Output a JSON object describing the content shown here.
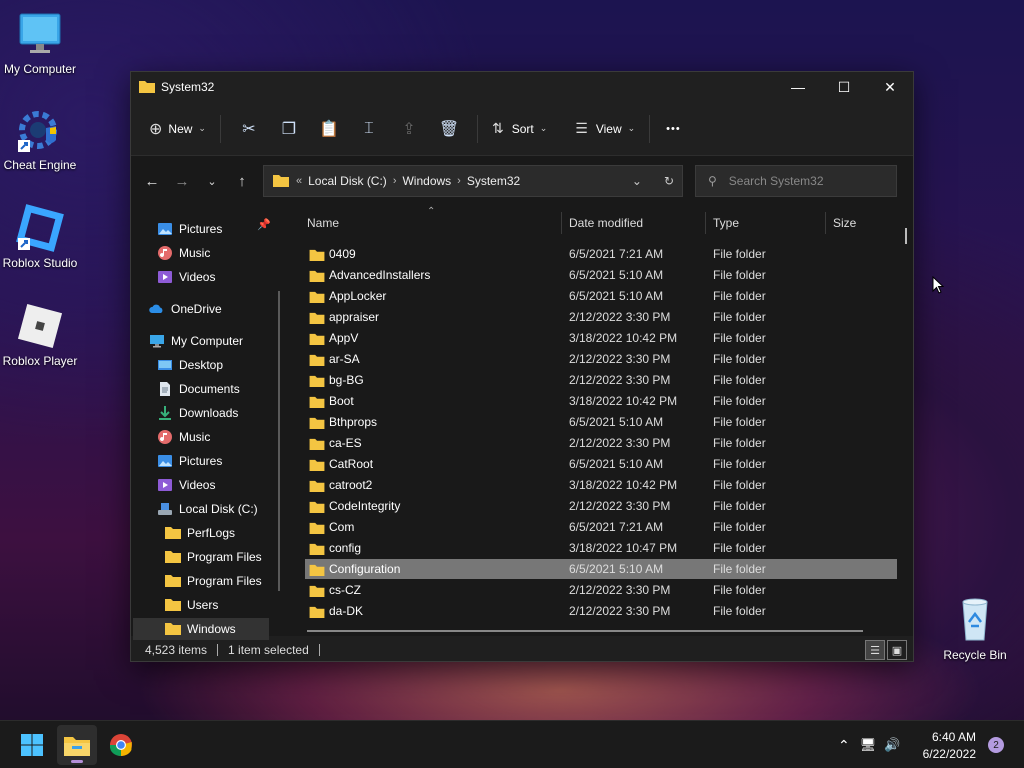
{
  "desktop": {
    "icons": [
      {
        "label": "My Computer"
      },
      {
        "label": "Cheat Engine"
      },
      {
        "label": "Roblox Studio"
      },
      {
        "label": "Roblox Player"
      },
      {
        "label": "Recycle Bin"
      }
    ]
  },
  "window": {
    "title": "System32",
    "controls": {
      "minimize": "—",
      "maximize": "☐",
      "close": "✕"
    }
  },
  "toolbar": {
    "new_label": "New",
    "sort_label": "Sort",
    "view_label": "View",
    "more_label": "•••"
  },
  "address": {
    "prefix": "«",
    "crumbs": [
      "Local Disk (C:)",
      "Windows",
      "System32"
    ],
    "search_placeholder": "Search System32"
  },
  "nav": {
    "items": [
      {
        "label": "Pictures",
        "icon": "pictures-icon"
      },
      {
        "label": "Music",
        "icon": "music-icon"
      },
      {
        "label": "Videos",
        "icon": "videos-icon"
      },
      {
        "label": "OneDrive",
        "icon": "onedrive-icon"
      },
      {
        "label": "My Computer",
        "icon": "computer-icon"
      },
      {
        "label": "Desktop",
        "icon": "desktop-icon"
      },
      {
        "label": "Documents",
        "icon": "documents-icon"
      },
      {
        "label": "Downloads",
        "icon": "downloads-icon"
      },
      {
        "label": "Music",
        "icon": "music-icon"
      },
      {
        "label": "Pictures",
        "icon": "pictures-icon"
      },
      {
        "label": "Videos",
        "icon": "videos-icon"
      },
      {
        "label": "Local Disk (C:)",
        "icon": "drive-icon"
      },
      {
        "label": "PerfLogs",
        "icon": "folder-icon"
      },
      {
        "label": "Program Files",
        "icon": "folder-icon"
      },
      {
        "label": "Program Files",
        "icon": "folder-icon"
      },
      {
        "label": "Users",
        "icon": "folder-icon"
      },
      {
        "label": "Windows",
        "icon": "folder-icon"
      }
    ]
  },
  "columns": {
    "name": "Name",
    "date": "Date modified",
    "type": "Type",
    "size": "Size"
  },
  "files": [
    {
      "name": "0409",
      "date": "6/5/2021 7:21 AM",
      "type": "File folder"
    },
    {
      "name": "AdvancedInstallers",
      "date": "6/5/2021 5:10 AM",
      "type": "File folder"
    },
    {
      "name": "AppLocker",
      "date": "6/5/2021 5:10 AM",
      "type": "File folder"
    },
    {
      "name": "appraiser",
      "date": "2/12/2022 3:30 PM",
      "type": "File folder"
    },
    {
      "name": "AppV",
      "date": "3/18/2022 10:42 PM",
      "type": "File folder"
    },
    {
      "name": "ar-SA",
      "date": "2/12/2022 3:30 PM",
      "type": "File folder"
    },
    {
      "name": "bg-BG",
      "date": "2/12/2022 3:30 PM",
      "type": "File folder"
    },
    {
      "name": "Boot",
      "date": "3/18/2022 10:42 PM",
      "type": "File folder"
    },
    {
      "name": "Bthprops",
      "date": "6/5/2021 5:10 AM",
      "type": "File folder"
    },
    {
      "name": "ca-ES",
      "date": "2/12/2022 3:30 PM",
      "type": "File folder"
    },
    {
      "name": "CatRoot",
      "date": "6/5/2021 5:10 AM",
      "type": "File folder"
    },
    {
      "name": "catroot2",
      "date": "3/18/2022 10:42 PM",
      "type": "File folder"
    },
    {
      "name": "CodeIntegrity",
      "date": "2/12/2022 3:30 PM",
      "type": "File folder"
    },
    {
      "name": "Com",
      "date": "6/5/2021 7:21 AM",
      "type": "File folder"
    },
    {
      "name": "config",
      "date": "3/18/2022 10:47 PM",
      "type": "File folder"
    },
    {
      "name": "Configuration",
      "date": "6/5/2021 5:10 AM",
      "type": "File folder"
    },
    {
      "name": "cs-CZ",
      "date": "2/12/2022 3:30 PM",
      "type": "File folder"
    },
    {
      "name": "da-DK",
      "date": "2/12/2022 3:30 PM",
      "type": "File folder"
    }
  ],
  "status": {
    "count": "4,523 items",
    "selected": "1 item selected"
  },
  "taskbar": {
    "time": "6:40 AM",
    "date": "6/22/2022",
    "notifications": "2"
  },
  "colors": {
    "folder": "#f4c542",
    "accent": "#b49be0",
    "window_bg": "#1f1f1f"
  }
}
